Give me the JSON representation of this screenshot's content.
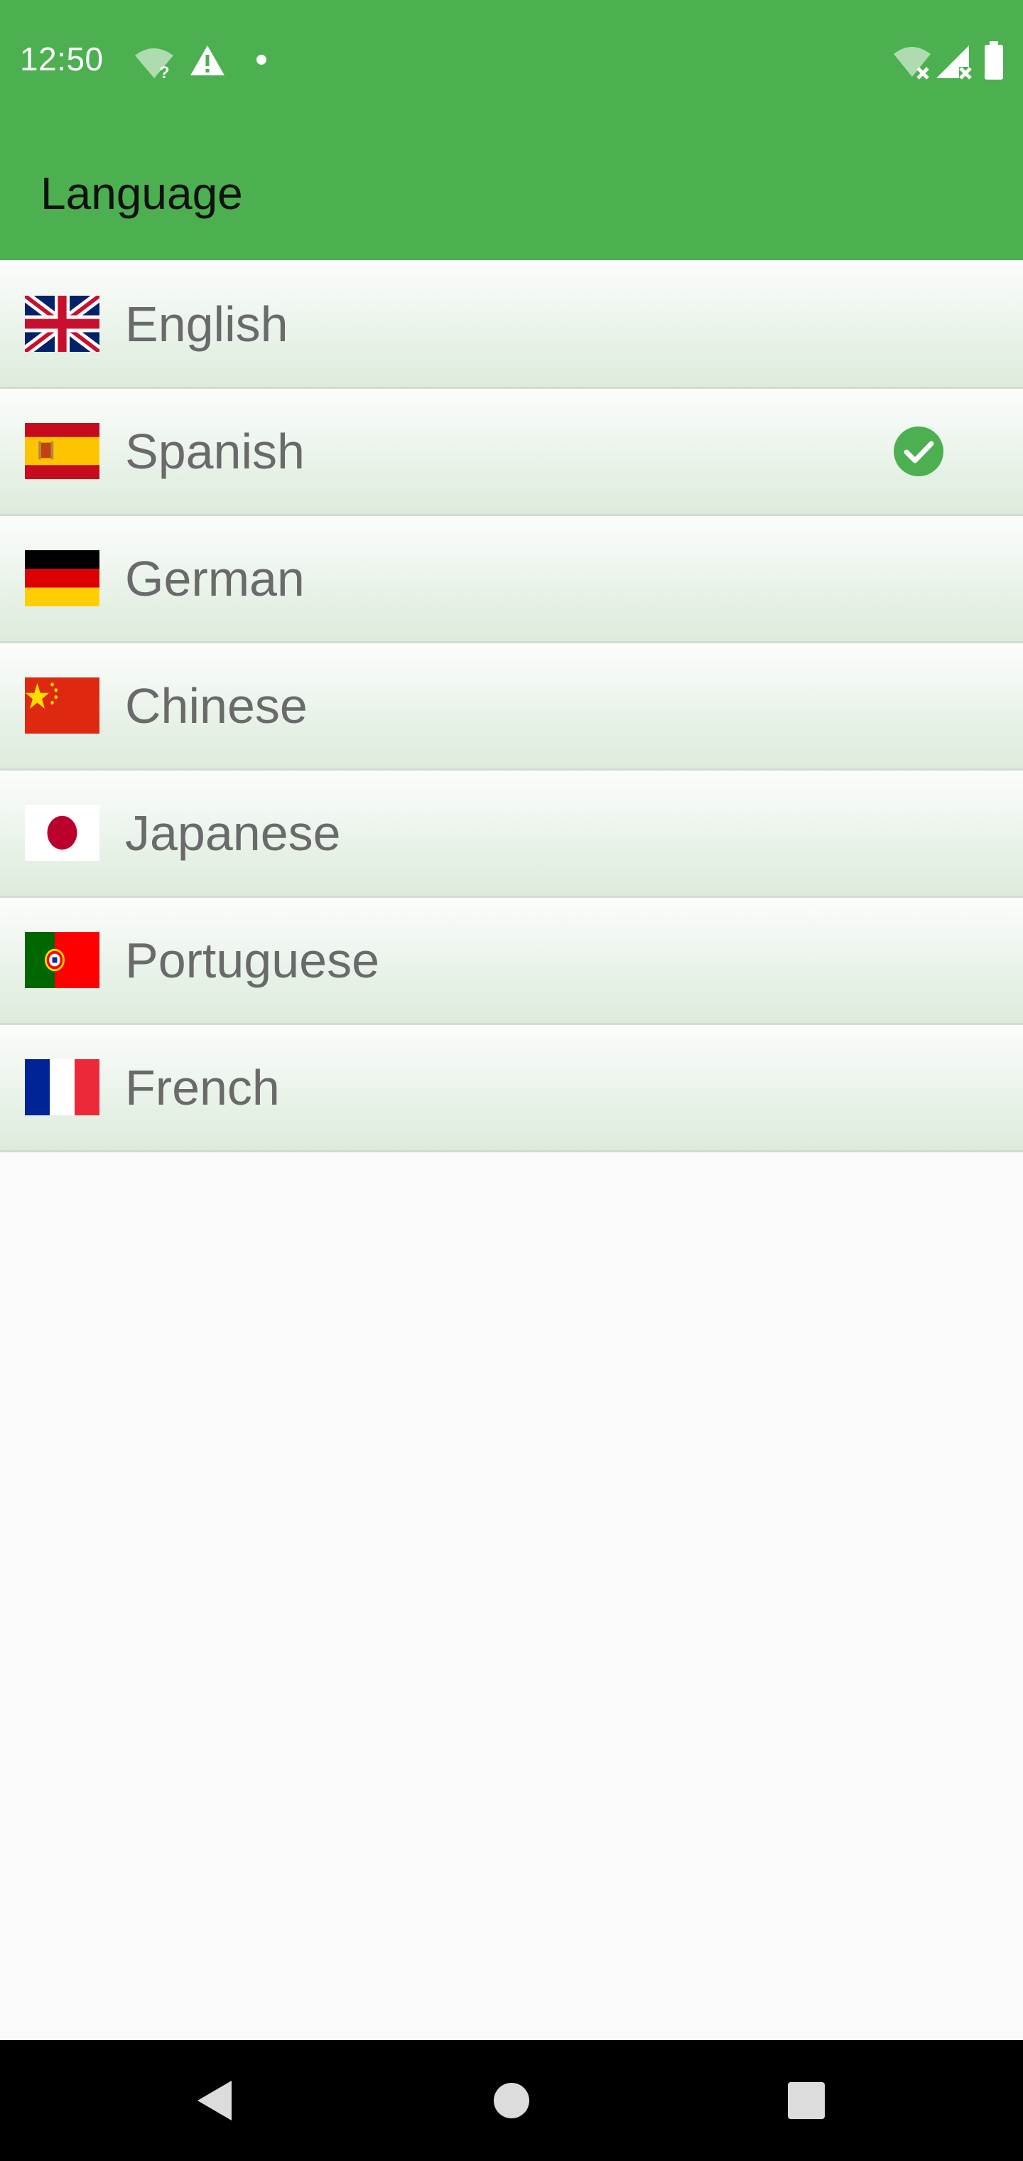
{
  "status_bar": {
    "time": "12:50",
    "icons": [
      "wifi-question-icon",
      "warning-icon",
      "notification-dot-icon",
      "wifi-off-icon",
      "signal-off-icon",
      "battery-icon"
    ]
  },
  "app_bar": {
    "title": "Language",
    "color": "#4caf50"
  },
  "languages": [
    {
      "label": "English",
      "flag": "uk-flag-icon",
      "selected": false
    },
    {
      "label": "Spanish",
      "flag": "spain-flag-icon",
      "selected": true
    },
    {
      "label": "German",
      "flag": "germany-flag-icon",
      "selected": false
    },
    {
      "label": "Chinese",
      "flag": "china-flag-icon",
      "selected": false
    },
    {
      "label": "Japanese",
      "flag": "japan-flag-icon",
      "selected": false
    },
    {
      "label": "Portuguese",
      "flag": "portugal-flag-icon",
      "selected": false
    },
    {
      "label": "French",
      "flag": "france-flag-icon",
      "selected": false
    }
  ],
  "selected_indicator": {
    "icon": "check-circle-icon",
    "color": "#4caf50"
  },
  "nav_bar": {
    "buttons": [
      "back-icon",
      "home-icon",
      "recents-icon"
    ]
  }
}
